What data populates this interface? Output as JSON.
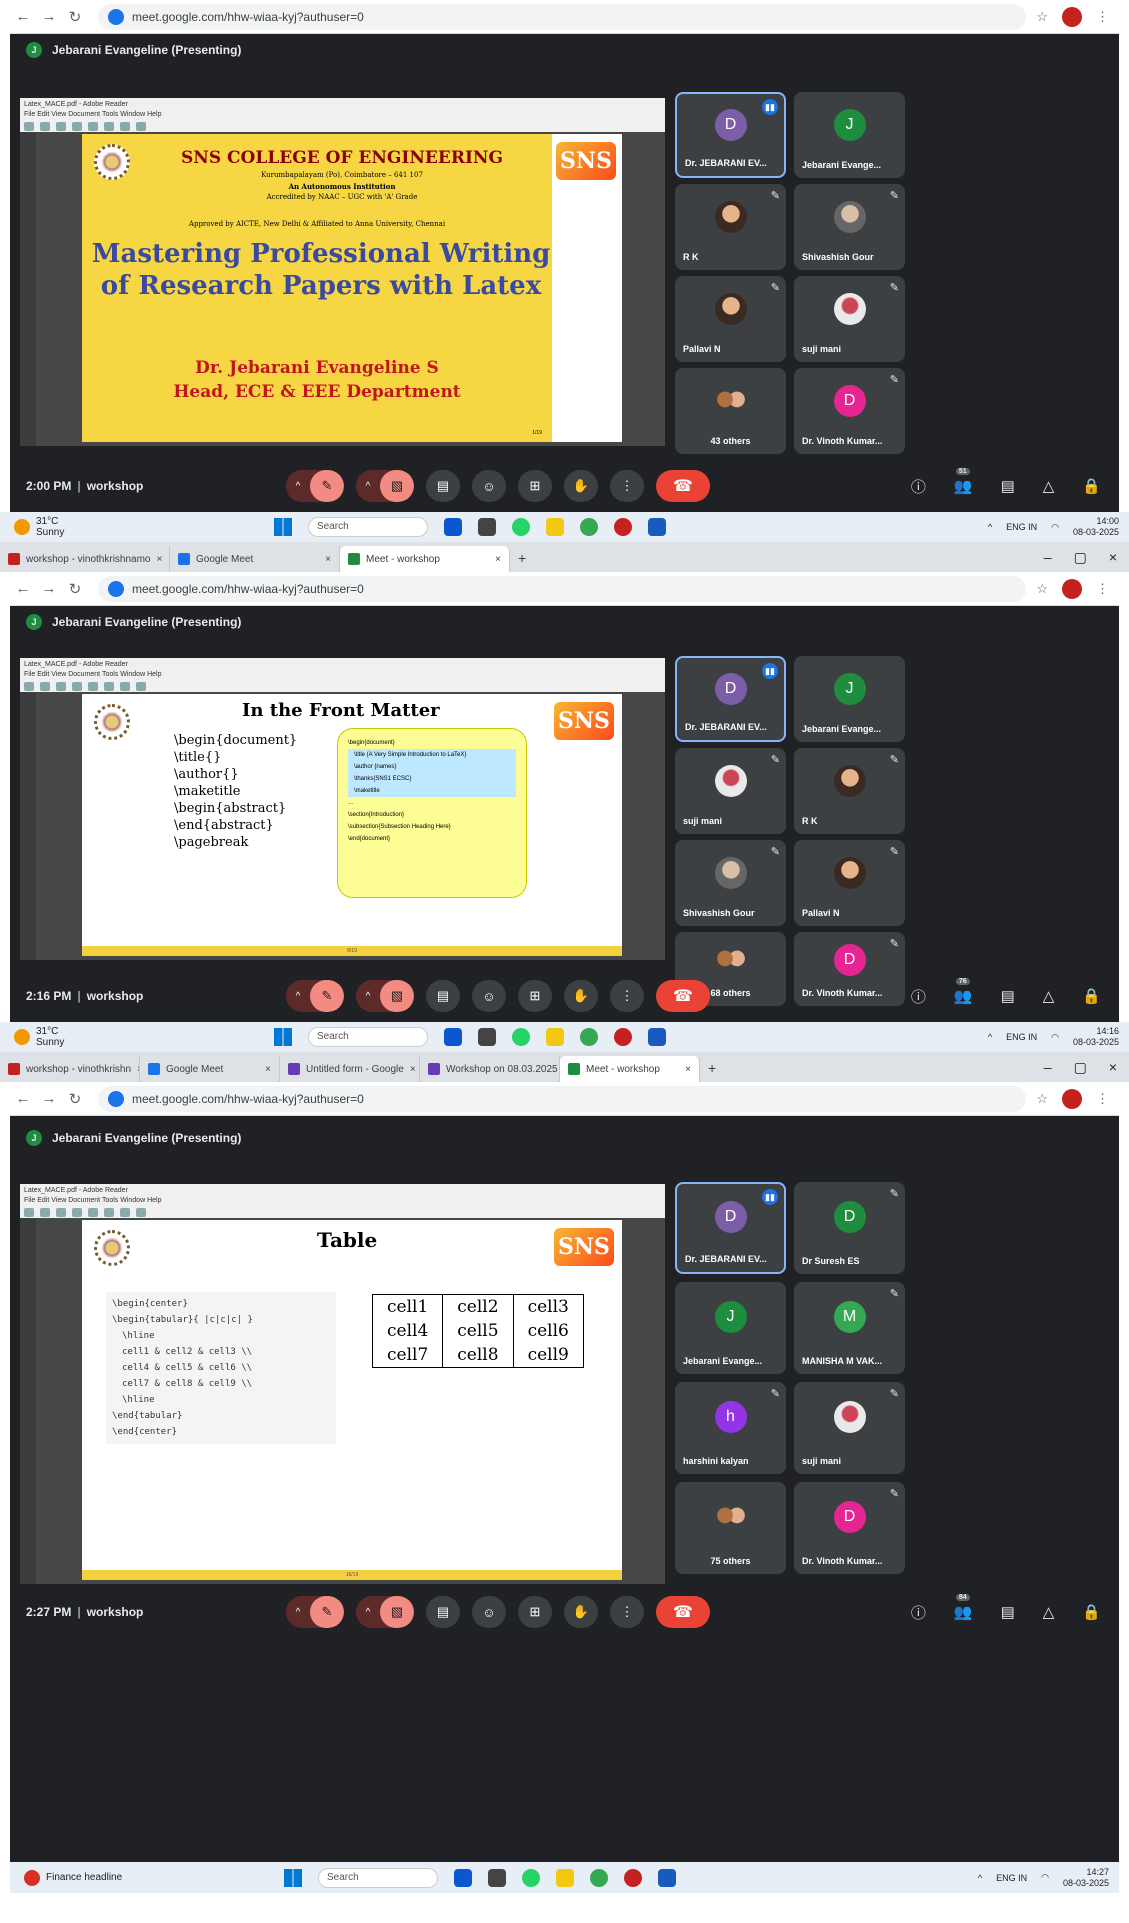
{
  "url": "meet.google.com/hhw-wiaa-kyj?authuser=0",
  "meeting": "workshop",
  "presenter_1": "Jebarani Evangeline (Presenting)",
  "presenter": "Jebarani Evangeline (Presenting)",
  "pdf_title": "Latex_MACE.pdf - Adobe Reader",
  "pdf_menu": "File Edit View Document Tools Window Help",
  "slide1": {
    "college": "SNS COLLEGE OF ENGINEERING",
    "place": "Kurumbapalayam (Po), Coimbatore – 641 107",
    "auto": "An Autonomous Institution",
    "acc": "Accredited by NAAC – UGC with 'A' Grade",
    "app": "Approved by AICTE, New Delhi & Affiliated to Anna University, Chennai",
    "title": "Mastering Professional Writing of Research Papers with Latex",
    "author": "Dr. Jebarani Evangeline S",
    "dept": "Head, ECE & EEE Department",
    "page": "1/19"
  },
  "slide2": {
    "title": "In the Front Matter",
    "items": [
      "\\begin{document}",
      "\\title{}",
      "\\author{}",
      "\\maketitle",
      "\\begin{abstract}",
      "\\end{abstract}",
      "\\pagebreak"
    ],
    "box": [
      "\\begin{document}",
      "\\title {A Very Simple Introduction to LaTeX}",
      "\\author {names}",
      "\\thanks{SNS1 ECSC}",
      "\\maketitle",
      "...",
      "\\section{Introduction}",
      "\\subsection{Subsection Heading Here}",
      "\\end{document}"
    ],
    "page": "8/19"
  },
  "slide3": {
    "title": "Table",
    "code": [
      "\\begin{center}",
      "\\begin{tabular}{ |c|c|c| }",
      "\\hline",
      "cell1 & cell2 & cell3 \\\\",
      "cell4 & cell5 & cell6 \\\\",
      "cell7 & cell8 & cell9 \\\\",
      "\\hline",
      "\\end{tabular}",
      "\\end{center}"
    ],
    "cells": [
      [
        "cell1",
        "cell2",
        "cell3"
      ],
      [
        "cell4",
        "cell5",
        "cell6"
      ],
      [
        "cell7",
        "cell8",
        "cell9"
      ]
    ],
    "page": "16/19"
  },
  "p1": {
    "time": "2:00 PM",
    "count": "51",
    "tiles": [
      "Dr. JEBARANI EV...",
      "Jebarani Evange...",
      "R K",
      "Shivashish Gour",
      "Pallavi N",
      "suji mani",
      "43 others",
      "Dr. Vinoth Kumar..."
    ]
  },
  "p2": {
    "time": "2:16 PM",
    "count": "76",
    "tiles": [
      "Dr. JEBARANI EV...",
      "Jebarani Evange...",
      "suji mani",
      "R K",
      "Shivashish Gour",
      "Pallavi N",
      "68 others",
      "Dr. Vinoth Kumar..."
    ],
    "tabs": [
      "workshop - vinothkrishnamo",
      "Google Meet",
      "Meet - workshop"
    ]
  },
  "p3": {
    "time": "2:27 PM",
    "count": "84",
    "tiles": [
      "Dr. JEBARANI EV...",
      "Dr Suresh ES",
      "Jebarani Evange...",
      "MANISHA M VAK...",
      "harshini kalyan",
      "suji mani",
      "75 others",
      "Dr. Vinoth Kumar..."
    ],
    "tabs": [
      "workshop - vinothkrishn",
      "Google Meet",
      "Untitled form - Google",
      "Workshop on 08.03.2025",
      "Meet - workshop"
    ]
  },
  "weather": {
    "temp": "31°C",
    "cond": "Sunny"
  },
  "search": "Search",
  "lang": "ENG IN",
  "clock1": {
    "t": "14:00",
    "d": "08-03-2025"
  },
  "clock2": {
    "t": "14:16",
    "d": "08-03-2025"
  },
  "clock3": {
    "t": "14:27",
    "d": "08-03-2025"
  },
  "news": "Finance headline"
}
